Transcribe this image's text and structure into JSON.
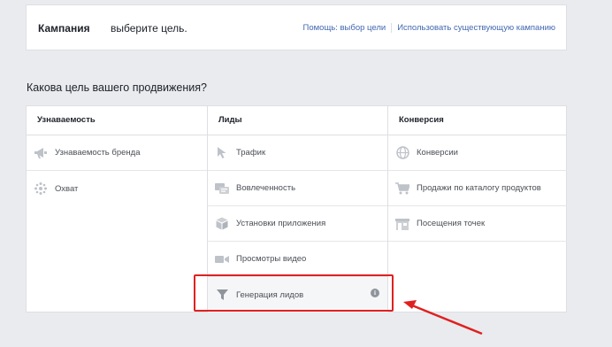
{
  "header": {
    "title": "Кампания",
    "subtitle": "выберите цель.",
    "help_link": "Помощь: выбор цели",
    "existing_link": "Использовать существующую кампанию"
  },
  "question": "Какова цель вашего продвижения?",
  "columns": [
    {
      "title": "Узнаваемость",
      "items": [
        {
          "label": "Узнаваемость бренда",
          "icon": "megaphone-icon"
        },
        {
          "label": "Охват",
          "icon": "snowflake-icon"
        }
      ]
    },
    {
      "title": "Лиды",
      "items": [
        {
          "label": "Трафик",
          "icon": "cursor-icon"
        },
        {
          "label": "Вовлеченность",
          "icon": "chat-icon"
        },
        {
          "label": "Установки приложения",
          "icon": "box-icon"
        },
        {
          "label": "Просмотры видео",
          "icon": "video-camera-icon"
        },
        {
          "label": "Генерация лидов",
          "icon": "funnel-icon",
          "selected": true
        }
      ]
    },
    {
      "title": "Конверсия",
      "items": [
        {
          "label": "Конверсии",
          "icon": "globe-icon"
        },
        {
          "label": "Продажи по каталогу продуктов",
          "icon": "cart-icon"
        },
        {
          "label": "Посещения точек",
          "icon": "store-icon"
        }
      ]
    }
  ],
  "colors": {
    "link": "#4267b2",
    "highlight": "#e02020",
    "icon": "#bec2c9",
    "background": "#e9ebee"
  }
}
